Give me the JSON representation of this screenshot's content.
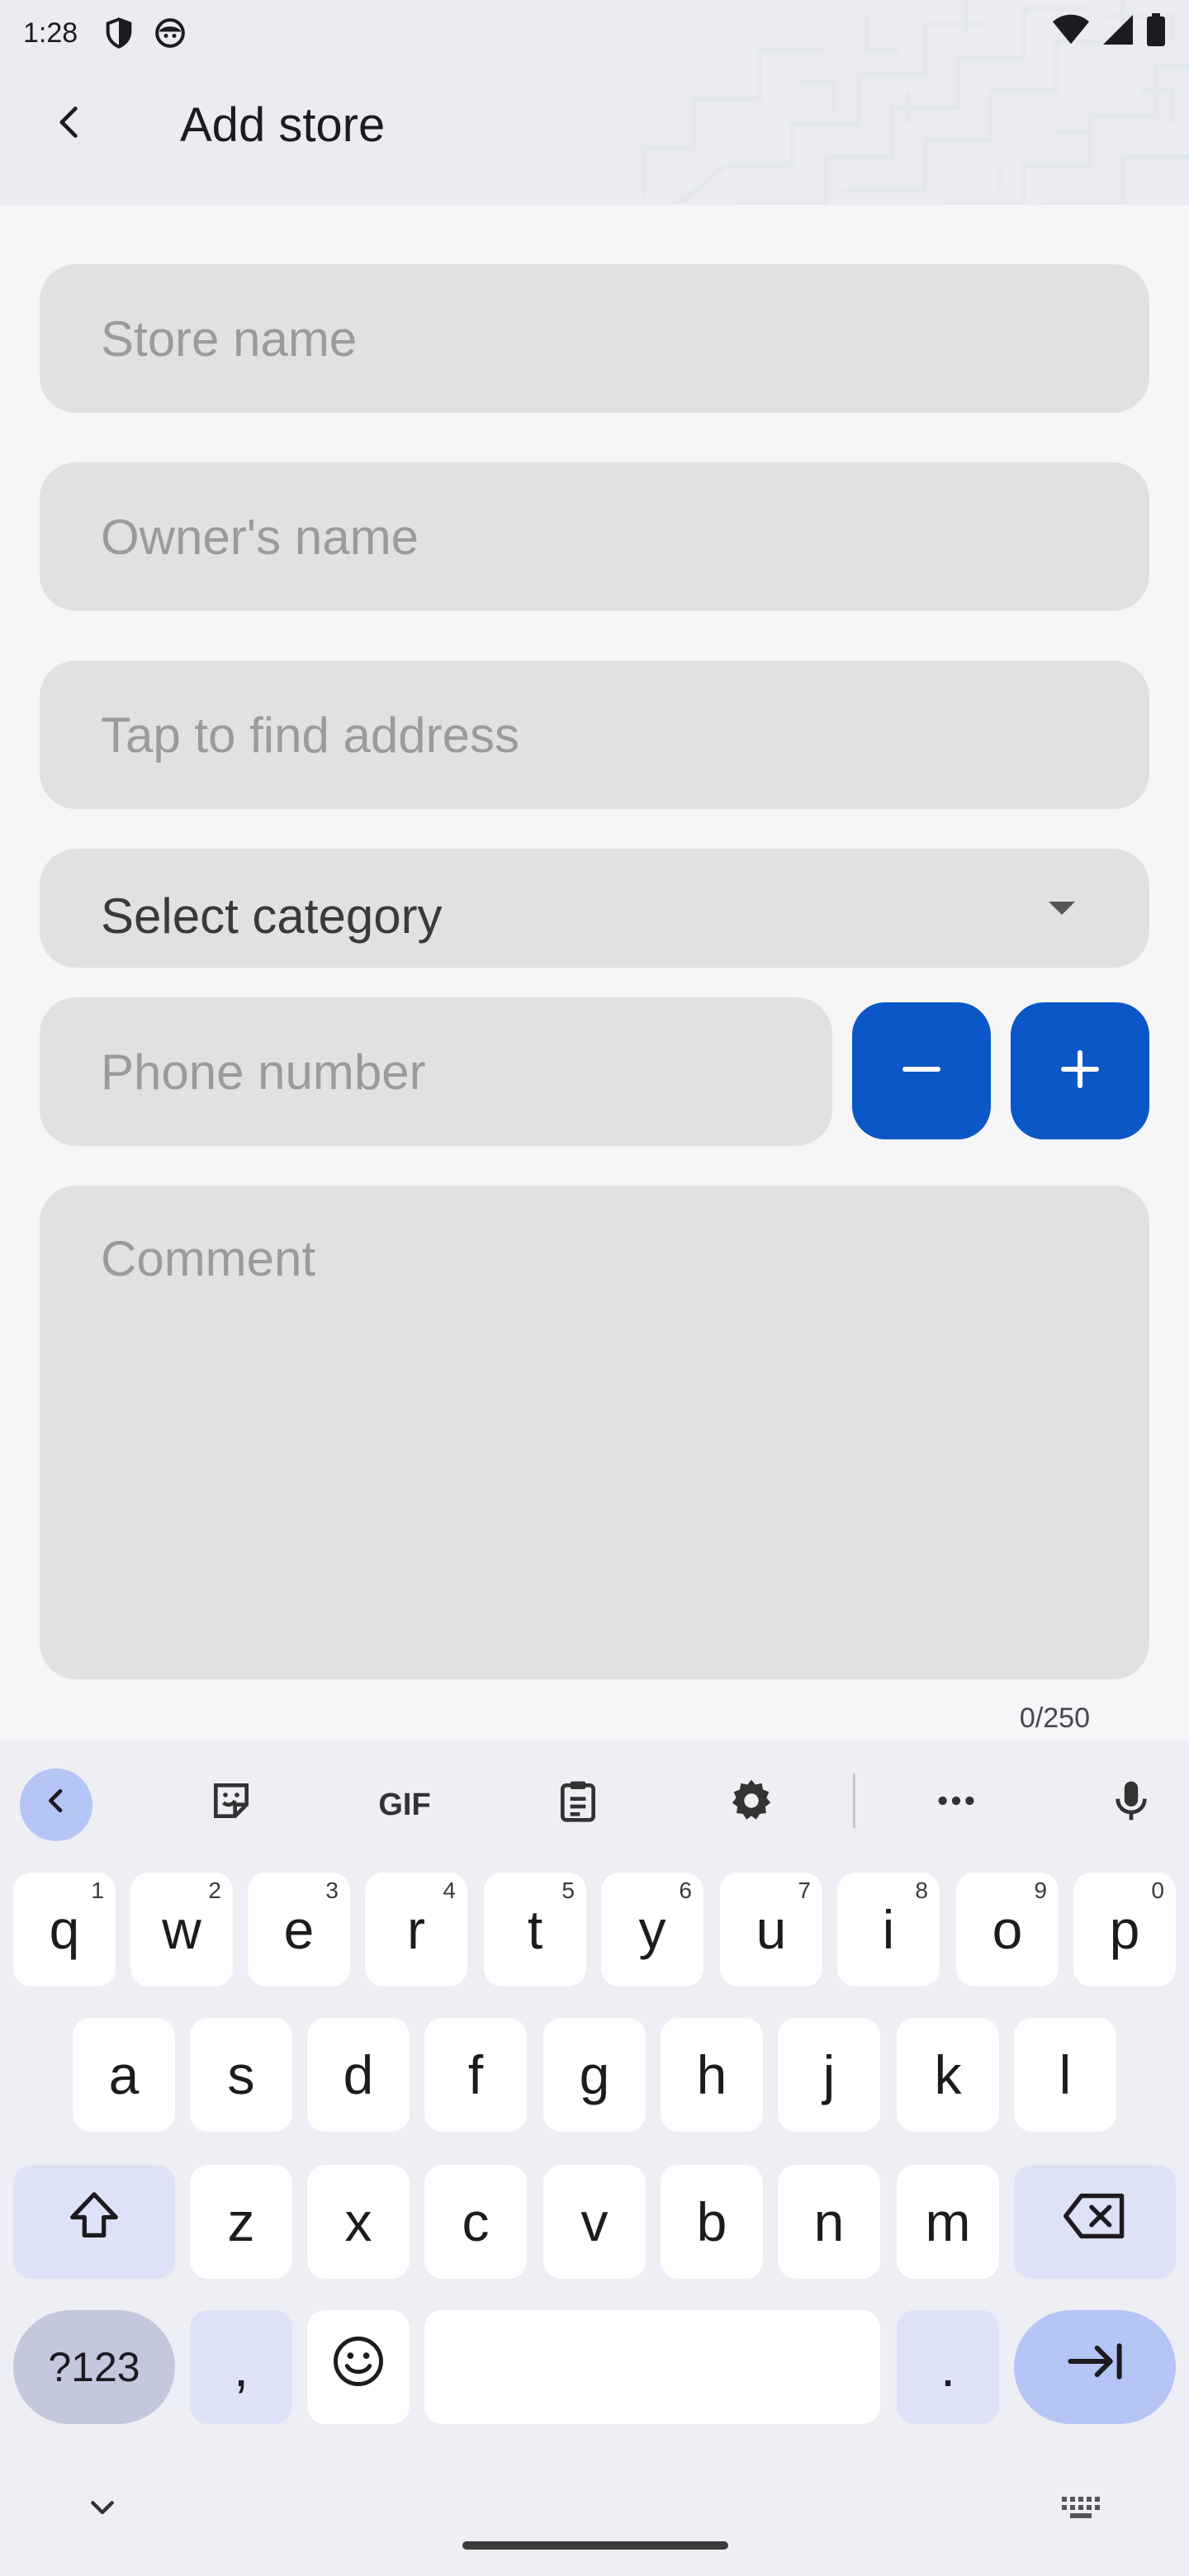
{
  "status_bar": {
    "time": "1:28"
  },
  "header": {
    "title": "Add store",
    "back_icon": "arrow-back-icon"
  },
  "form": {
    "store_name_placeholder": "Store name",
    "owner_name_placeholder": "Owner's name",
    "address_placeholder": "Tap to find address",
    "category_value": "Select category",
    "phone_placeholder": "Phone number",
    "comment_placeholder": "Comment",
    "comment_counter": "0/250"
  },
  "colors": {
    "primary": "#0b57c7",
    "field_bg": "#e1e1e1",
    "key_accent": "#b5c5f6"
  },
  "keyboard": {
    "toolbar": {
      "gif_label": "GIF",
      "icons": [
        "chevron-left-icon",
        "sticker-icon",
        "gif-icon",
        "clipboard-icon",
        "settings-icon",
        "more-icon",
        "microphone-icon"
      ]
    },
    "row1": [
      {
        "k": "q",
        "h": "1"
      },
      {
        "k": "w",
        "h": "2"
      },
      {
        "k": "e",
        "h": "3"
      },
      {
        "k": "r",
        "h": "4"
      },
      {
        "k": "t",
        "h": "5"
      },
      {
        "k": "y",
        "h": "6"
      },
      {
        "k": "u",
        "h": "7"
      },
      {
        "k": "i",
        "h": "8"
      },
      {
        "k": "o",
        "h": "9"
      },
      {
        "k": "p",
        "h": "0"
      }
    ],
    "row2": [
      "a",
      "s",
      "d",
      "f",
      "g",
      "h",
      "j",
      "k",
      "l"
    ],
    "row3": [
      "z",
      "x",
      "c",
      "v",
      "b",
      "n",
      "m"
    ],
    "symbols_label": "?123",
    "comma_label": ",",
    "period_label": "."
  }
}
